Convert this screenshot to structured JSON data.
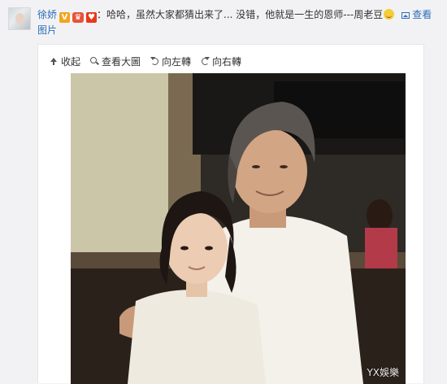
{
  "post": {
    "username": "徐娇",
    "text_before_emoji": "：哈哈，虽然大家都猜出来了... 没错，他就是一生的恩师---周老豆",
    "view_pic_label": "查看图片"
  },
  "toolbar": {
    "collapse": "收起",
    "view_large": "查看大圖",
    "rotate_left": "向左轉",
    "rotate_right": "向右轉"
  },
  "photo": {
    "watermark": "YX娛樂"
  },
  "icons": [
    "v-badge-icon",
    "vip-icon",
    "crown-icon",
    "grin-emoji-icon",
    "picture-icon",
    "collapse-arrow-icon",
    "magnifier-icon",
    "rotate-left-icon",
    "rotate-right-icon"
  ],
  "colors": {
    "link": "#2c6fb5",
    "background": "#f2f2f5"
  }
}
